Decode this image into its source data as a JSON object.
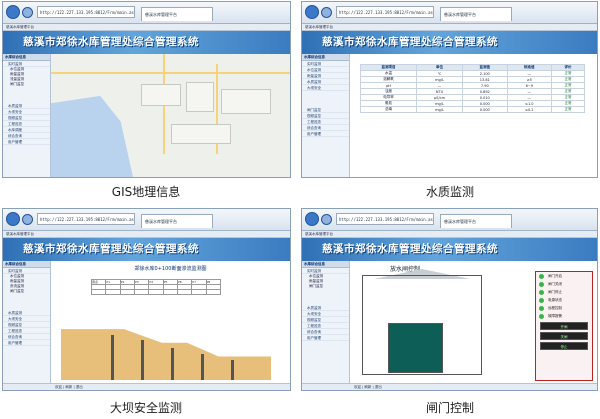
{
  "shared": {
    "url": "http://122.227.133.195:8012/Frm/main.aspx",
    "tab_title": "慈溪水库管理平台",
    "menu_bar": "慈溪水库管理平台",
    "system_title": "慈溪市郑徐水库管理处综合管理系统",
    "status_text": "欢迎 | 刷新 | 退出"
  },
  "panels": [
    {
      "caption": "GIS地理信息",
      "sidebar_header": "水库综合信息",
      "sidebar_items": [
        "实时监测",
        "水位监测",
        "雨量监测",
        "流量监测",
        "闸门监控",
        "水质监测",
        "大坝安全",
        "视频监控",
        "工程巡查",
        "水库调度",
        "综合查询",
        "用户管理"
      ]
    },
    {
      "caption": "水质监测",
      "sidebar_header": "水库综合信息",
      "sidebar_items": [
        "实时监测",
        "水位监测",
        "雨量监测",
        "水质监测",
        "大坝安全",
        "闸门监控",
        "视频监控",
        "工程巡查",
        "综合查询",
        "用户管理"
      ],
      "table": {
        "headers": [
          "监测项目",
          "单位",
          "监测值",
          "标准值",
          "评价"
        ],
        "rows": [
          [
            "水温",
            "℃",
            "2.100",
            "—",
            "正常"
          ],
          [
            "溶解氧",
            "mg/L",
            "13.81",
            "≥5",
            "正常"
          ],
          [
            "pH",
            "—",
            "7.90",
            "6~9",
            "正常"
          ],
          [
            "浊度",
            "NTU",
            "0.892",
            "—",
            "正常"
          ],
          [
            "电导率",
            "μS/cm",
            "0.010",
            "—",
            "正常"
          ],
          [
            "氨氮",
            "mg/L",
            "0.000",
            "≤1.0",
            "正常"
          ],
          [
            "总磷",
            "mg/L",
            "0.000",
            "≤0.2",
            "正常"
          ]
        ]
      }
    },
    {
      "caption": "大坝安全监测",
      "sidebar_header": "水库综合信息",
      "sidebar_items": [
        "实时监测",
        "水位监测",
        "雨量监测",
        "渗流监测",
        "闸门监控",
        "水质监测",
        "大坝安全",
        "视频监控",
        "工程巡查",
        "综合查询",
        "用户管理"
      ],
      "dam_title": "郑徐水库0+100断面渗流监测图",
      "grid_headers": [
        "测点",
        "P1",
        "P2",
        "P3",
        "P4",
        "P5",
        "P6",
        "P7",
        "P8"
      ]
    },
    {
      "caption": "闸门控制",
      "sidebar_header": "水库综合信息",
      "sidebar_items": [
        "实时监测",
        "水位监测",
        "雨量监测",
        "闸门监控",
        "水质监测",
        "大坝安全",
        "视频监控",
        "工程巡查",
        "综合查询",
        "用户管理"
      ],
      "gate_title": "放水闸控制",
      "control_rows": [
        "闸门开启",
        "闸门关闭",
        "闸门停止",
        "电源状态",
        "远程控制",
        "故障报警"
      ],
      "control_buttons": [
        "开闸",
        "关闸",
        "停止"
      ]
    }
  ]
}
